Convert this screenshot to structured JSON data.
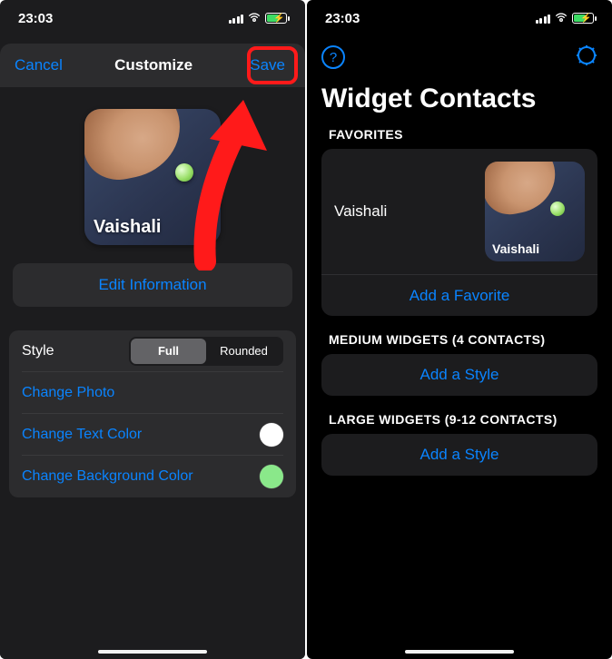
{
  "status": {
    "time": "23:03"
  },
  "left": {
    "cancel": "Cancel",
    "title": "Customize",
    "save": "Save",
    "contactName": "Vaishali",
    "editInfo": "Edit Information",
    "styleLabel": "Style",
    "segFull": "Full",
    "segRounded": "Rounded",
    "changePhoto": "Change Photo",
    "changeTextColor": "Change Text Color",
    "changeBgColor": "Change Background Color"
  },
  "right": {
    "title": "Widget Contacts",
    "favoritesLabel": "FAVORITES",
    "favName": "Vaishali",
    "favThumbName": "Vaishali",
    "addFavorite": "Add a Favorite",
    "mediumLabel": "MEDIUM WIDGETS (4 CONTACTS)",
    "addStyleMedium": "Add a Style",
    "largeLabel": "LARGE WIDGETS (9-12 CONTACTS)",
    "addStyleLarge": "Add a Style"
  }
}
